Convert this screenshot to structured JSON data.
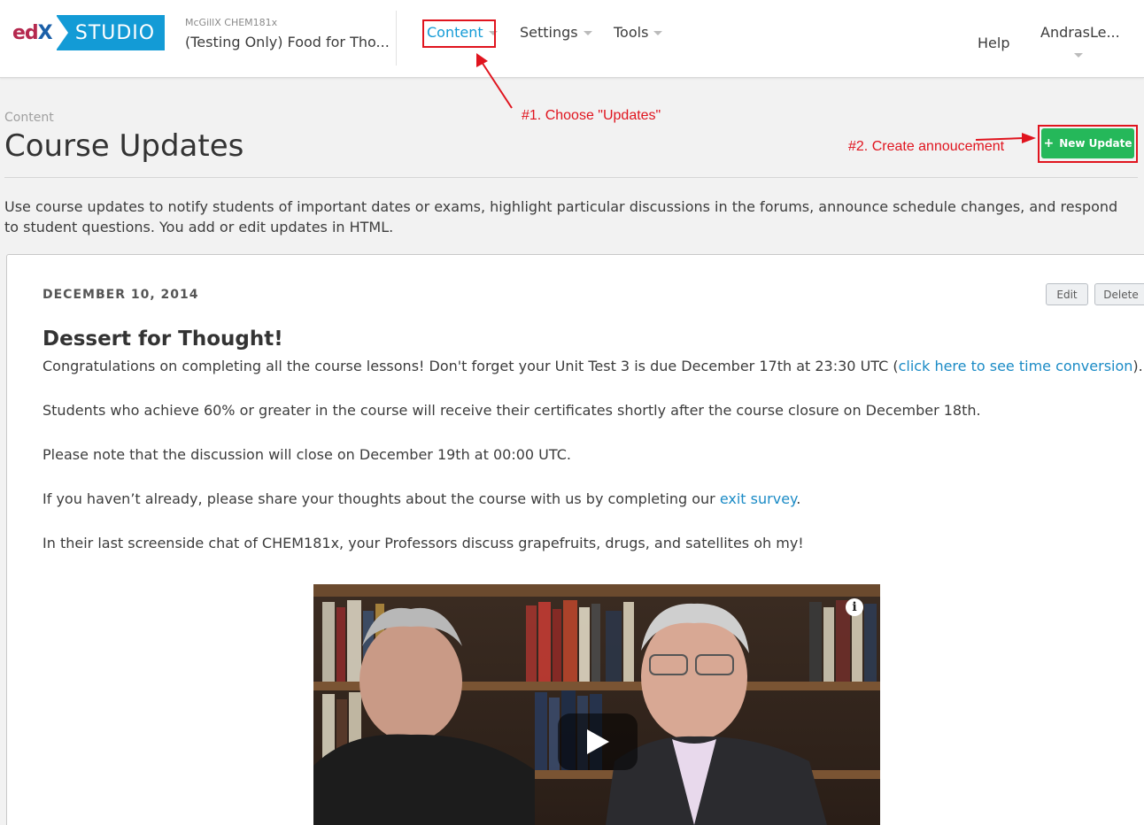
{
  "header": {
    "logo_edx_prefix": "ed",
    "logo_edx_x": "X",
    "logo_studio": "STUDIO",
    "course_org": "McGillX  CHEM181x",
    "course_title": "(Testing Only) Food for Tho...",
    "nav": [
      {
        "label": "Content",
        "active": true
      },
      {
        "label": "Settings",
        "active": false
      },
      {
        "label": "Tools",
        "active": false
      }
    ],
    "help": "Help",
    "user": "AndrasLe..."
  },
  "annotations": {
    "step1": "#1. Choose \"Updates\"",
    "step2": "#2. Create annoucement"
  },
  "page": {
    "breadcrumb": "Content",
    "title": "Course Updates",
    "new_update_label": "New Update",
    "intro": "Use course updates to notify students of important dates or exams, highlight particular discussions in the forums, announce schedule changes, and respond to student questions. You add or edit updates in HTML."
  },
  "update": {
    "date": "DECEMBER 10, 2014",
    "edit_label": "Edit",
    "delete_label": "Delete",
    "title": "Dessert for Thought!",
    "p1_before": "Congratulations on completing all the course lessons! Don't forget your Unit Test 3 is due December 17th at 23:30 UTC (",
    "p1_link": "click here to see time conversion",
    "p1_after": ").",
    "p2": "Students who achieve 60% or greater in the course will receive their certificates shortly after the course closure on December 18th.",
    "p3": "Please note that the discussion will close on December 19th at 00:00 UTC.",
    "p4_before": "If you haven’t already, please share your thoughts about the course with us by completing our ",
    "p4_link": "exit survey",
    "p4_after": ".",
    "p5": "In their last screenside chat of CHEM181x, your Professors discuss grapefruits, drugs, and satellites oh my!",
    "video_info_icon": "i"
  },
  "colors": {
    "brand_blue": "#139bd6",
    "new_update_green": "#25b85a",
    "annotation_red": "#e0141e",
    "link_blue": "#1b8bc6"
  },
  "icons": [
    "caret-down-icon",
    "plus-icon",
    "play-icon",
    "info-icon",
    "arrow-icon"
  ]
}
